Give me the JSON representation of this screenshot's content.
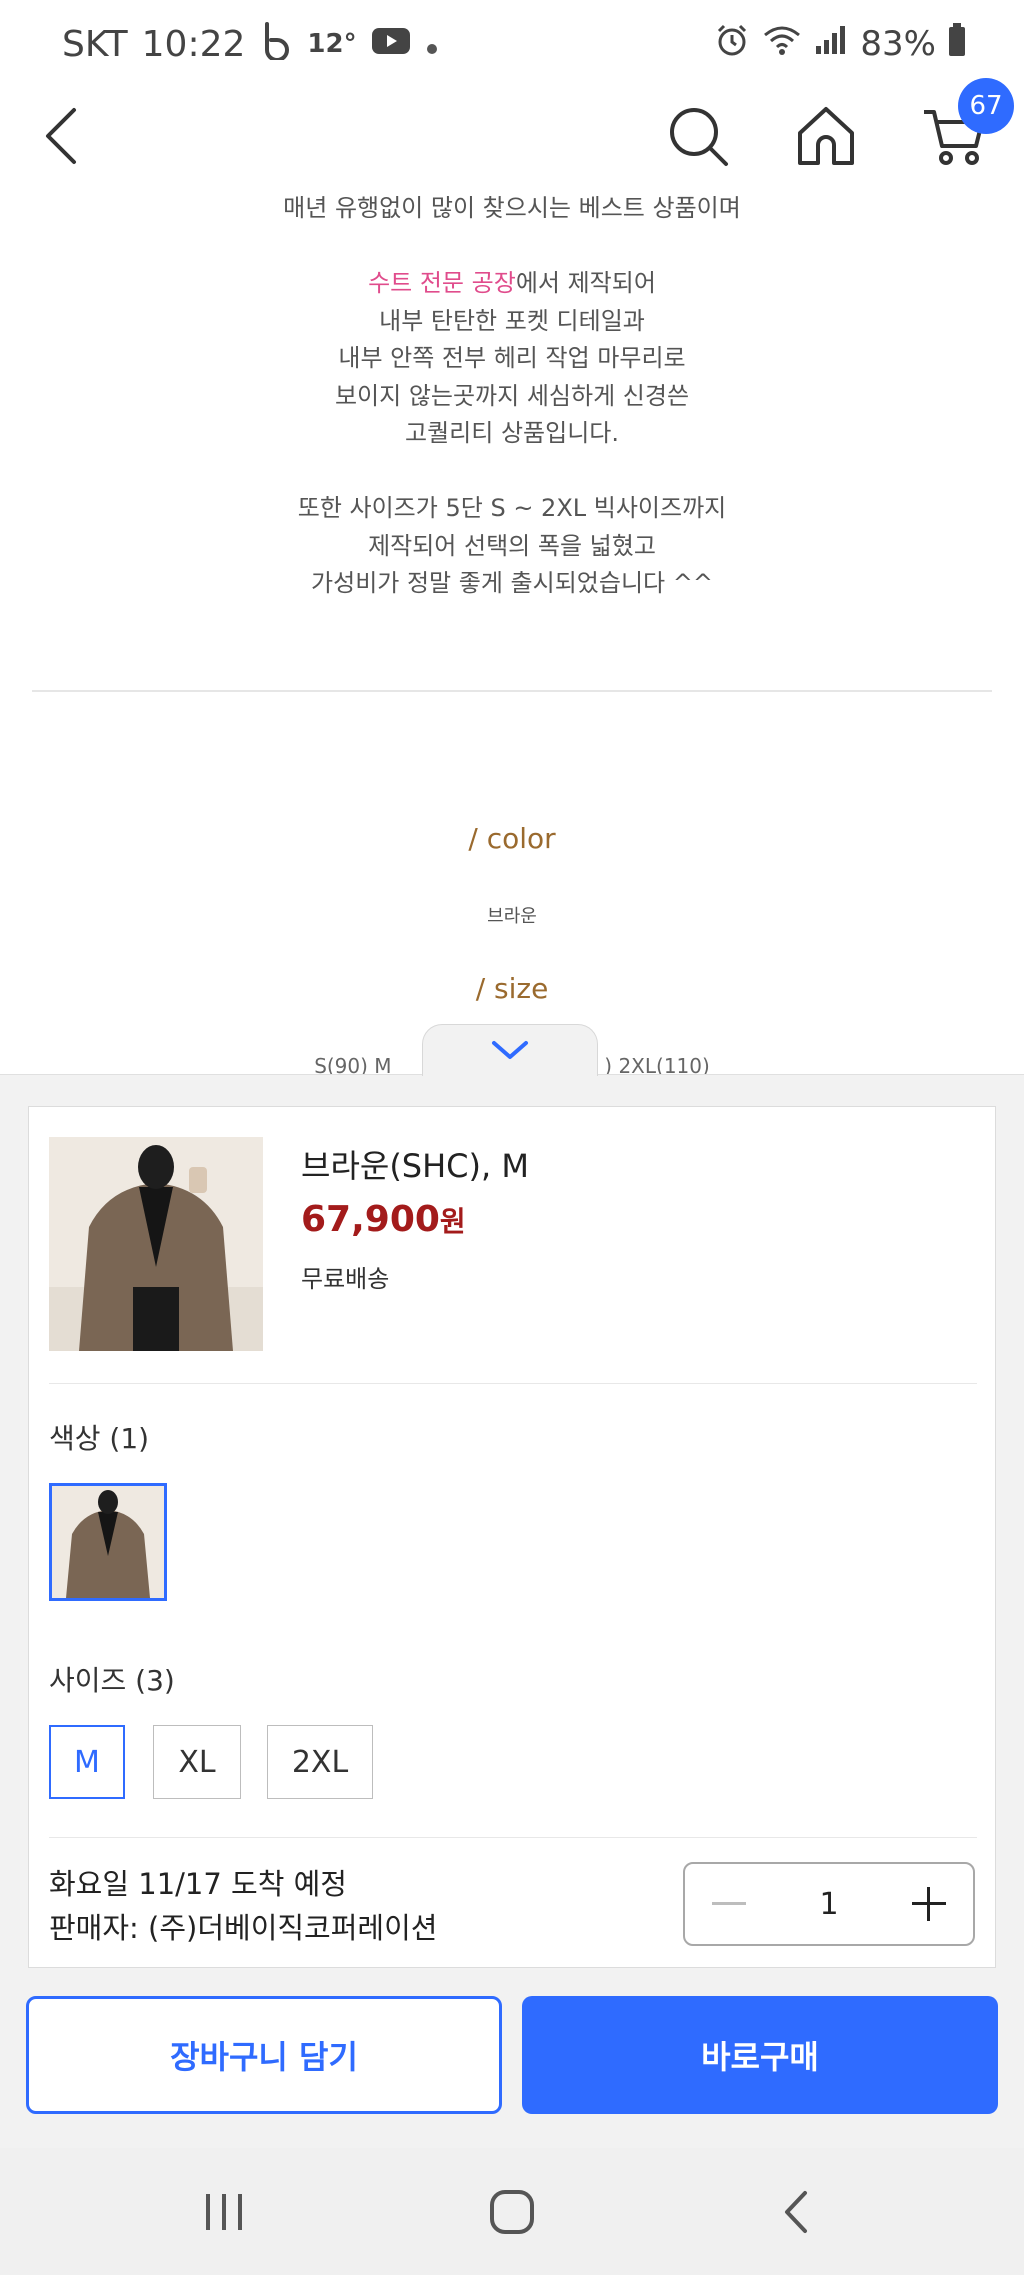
{
  "status_bar": {
    "carrier": "SKT",
    "time": "10:22",
    "temperature": "12°",
    "battery": "83%",
    "icons": [
      "b-app-icon",
      "youtube-icon",
      "alarm-icon",
      "wifi-icon",
      "signal-icon",
      "battery-icon"
    ]
  },
  "header": {
    "icons": [
      "back-arrow-icon",
      "search-icon",
      "home-icon",
      "cart-icon"
    ],
    "cart_count": "67"
  },
  "description": {
    "line1": "매년 유행없이 많이 찾으시는 베스트 상품이며",
    "highlight": "수트 전문 공장",
    "line2_rest": "에서 제작되어",
    "line3": "내부 탄탄한 포켓 디테일과",
    "line4": "내부 안쪽 전부 헤리 작업 마무리로",
    "line5": "보이지 않는곳까지 세심하게 신경쓴",
    "line6": "고퀄리티 상품입니다.",
    "line7": "또한 사이즈가 5단 S ~ 2XL 빅사이즈까지",
    "line8": "제작되어 선택의 폭을 넓혔고",
    "line9": "가성비가 정말 좋게 출시되었습니다 ^^",
    "color_title": "/ color",
    "color_value": "브라운",
    "size_title": "/ size",
    "size_line_left": "S(90)   M",
    "size_line_right": ")   2XL(110)"
  },
  "sheet": {
    "product_name": "브라운(SHC), M",
    "price": "67,900",
    "price_unit": "원",
    "shipping": "무료배송",
    "color_label": "색상 (1)",
    "size_label": "사이즈 (3)",
    "sizes": [
      {
        "label": "M",
        "selected": true
      },
      {
        "label": "XL",
        "selected": false
      },
      {
        "label": "2XL",
        "selected": false
      }
    ],
    "delivery": "화요일 11/17 도착 예정",
    "seller": "판매자: (주)더베이직코퍼레이션",
    "quantity": "1"
  },
  "actions": {
    "add_to_cart": "장바구니 담기",
    "buy_now": "바로구매"
  },
  "colors": {
    "accent": "#2f6bff",
    "price": "#a31b1b",
    "highlight": "#e04c8c",
    "section_title": "#9a6a2e"
  },
  "nav": {
    "icons": [
      "recent-apps-icon",
      "home-circle-icon",
      "back-chevron-icon"
    ]
  }
}
